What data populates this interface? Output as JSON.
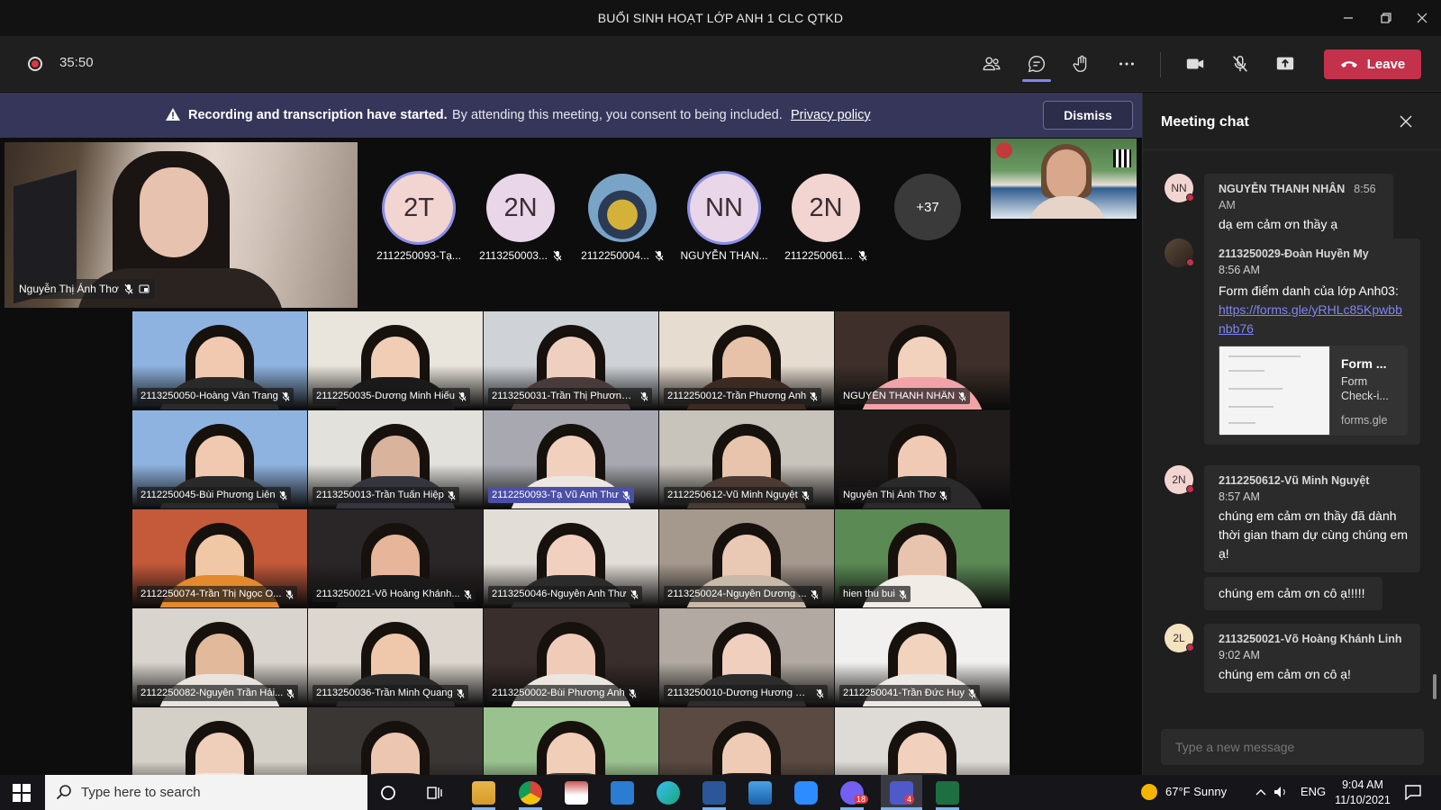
{
  "window": {
    "title": "BUỔI SINH HOẠT LỚP ANH 1 CLC QTKD"
  },
  "toolbar": {
    "timer": "35:50",
    "leave_label": "Leave"
  },
  "banner": {
    "bold": "Recording and transcription have started.",
    "text": "By attending this meeting, you consent to being included.",
    "link": "Privacy policy",
    "dismiss": "Dismiss"
  },
  "pinned": {
    "name": "Nguyễn Thị Ánh Thơ"
  },
  "avatars": [
    {
      "initials": "2T",
      "name": "2112250093-Tạ..."
    },
    {
      "initials": "2N",
      "name": "2113250003..."
    },
    {
      "initials": "",
      "name": "2112250004..."
    },
    {
      "initials": "NN",
      "name": "NGUYỄN THAN..."
    },
    {
      "initials": "2N",
      "name": "2112250061..."
    },
    {
      "initials": "+37",
      "name": ""
    }
  ],
  "gallery": [
    "2113250050-Hoàng Vân Trang",
    "2112250035-Dương Minh Hiếu",
    "2113250031-Trần Thị Phương ...",
    "2112250012-Trần Phương Anh",
    "NGUYỄN THANH NHÂN",
    "2112250045-Bùi Phương Liên",
    "2113250013-Trần Tuấn Hiệp",
    "2112250093-Tạ Vũ Anh Thư",
    "2112250612-Vũ Minh  Nguyệt",
    "Nguyễn Thị Ánh Thơ",
    "2112250074-Trần Thị Ngọc O...",
    "2113250021-Võ Hoàng Khánh...",
    "2113250046-Nguyễn Anh Thư",
    "2113250024-Nguyễn Dương ...",
    "hien thu bui",
    "2112250082-Nguyễn Trần Hải...",
    "2113250036-Trần Minh Quang",
    "2113250002-Bùi Phương Anh",
    "2113250010-Dương Hương Gi...",
    "2112250041-Trần Đức Huy",
    "",
    "",
    "",
    "",
    ""
  ],
  "chat": {
    "header": "Meeting chat",
    "messages": [
      {
        "initials": "NN",
        "sender": "NGUYỄN THANH NHÂN",
        "time": "8:56 AM",
        "text": "dạ em cảm ơn thầy ạ"
      },
      {
        "initials": "",
        "sender": "2113250029-Đoàn Huyền My",
        "time": "8:56 AM",
        "text": "Form điểm danh của lớp Anh03:",
        "link": "https://forms.gle/yRHLc85Kpwbbnbb76",
        "preview_title": "Form ...",
        "preview_desc": "Form Check-i...",
        "preview_domain": "forms.gle"
      },
      {
        "initials": "2N",
        "sender": "2112250612-Vũ Minh Nguyệt",
        "time": "8:57 AM",
        "text": "chúng em cảm ơn thầy đã dành thời gian tham dự cùng chúng em ạ!",
        "text2": "chúng em cảm ơn cô ạ!!!!!"
      },
      {
        "initials": "2L",
        "sender": "2113250021-Võ Hoàng Khánh Linh",
        "time": "9:02 AM",
        "text": "chúng em cảm ơn cô ạ!"
      }
    ],
    "compose_placeholder": "Type a new message"
  },
  "taskbar": {
    "search_placeholder": "Type here to search",
    "weather": "67°F  Sunny",
    "lang": "ENG",
    "time": "9:04 AM",
    "date": "11/10/2021",
    "badge_viber": "18",
    "badge_teams": "4"
  }
}
